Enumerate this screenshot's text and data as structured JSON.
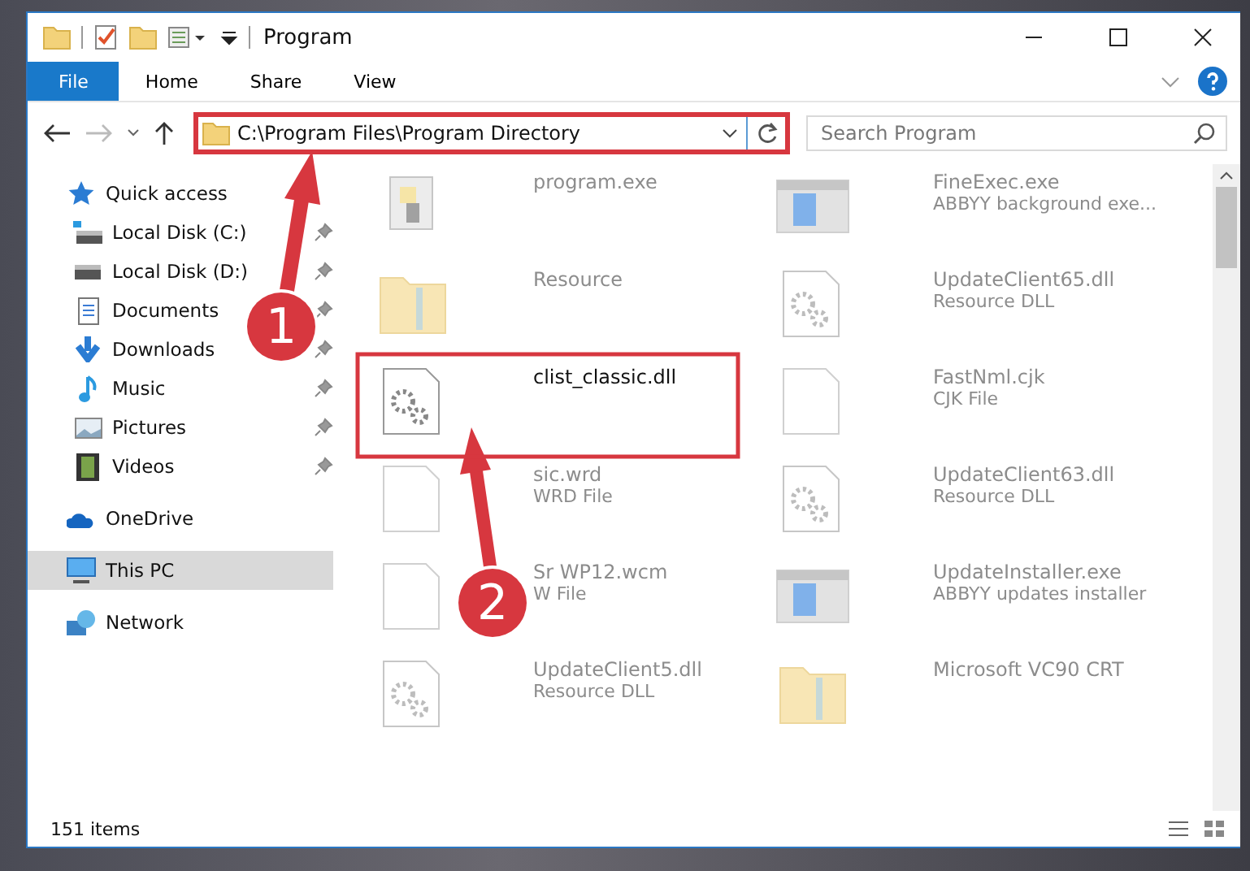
{
  "window": {
    "title": "Program"
  },
  "ribbon": {
    "tabs": [
      {
        "label": "File",
        "kind": "file"
      },
      {
        "label": "Home",
        "kind": "tab"
      },
      {
        "label": "Share",
        "kind": "tab"
      },
      {
        "label": "View",
        "kind": "tab"
      }
    ]
  },
  "address_bar": {
    "path": "C:\\Program Files\\Program Directory",
    "highlighted": true
  },
  "search": {
    "placeholder": "Search Program"
  },
  "nav_pane": {
    "items": [
      {
        "label": "Quick access",
        "selected": false,
        "children": [
          {
            "label": "Local Disk (C:)",
            "selected": false,
            "pinned": true
          },
          {
            "label": "Local Disk (D:)",
            "selected": false,
            "pinned": true
          },
          {
            "label": "Documents",
            "selected": false,
            "pinned": true
          },
          {
            "label": "Downloads",
            "selected": false,
            "pinned": true
          },
          {
            "label": "Music",
            "selected": false,
            "pinned": true
          },
          {
            "label": "Pictures",
            "selected": false,
            "pinned": true
          },
          {
            "label": "Videos",
            "selected": false,
            "pinned": true
          }
        ]
      },
      {
        "label": "OneDrive",
        "selected": false
      },
      {
        "label": "This PC",
        "selected": true
      },
      {
        "label": "Network",
        "selected": false
      }
    ]
  },
  "files": [
    {
      "name": "program.exe",
      "kind": "exe",
      "highlighted": false
    },
    {
      "name": "FineExec.exe",
      "type": "ABBYY background exe...",
      "kind": "app",
      "highlighted": false
    },
    {
      "name": "Resource",
      "kind": "folder",
      "highlighted": false
    },
    {
      "name": "UpdateClient65.dll",
      "type": "Resource DLL",
      "kind": "dll",
      "highlighted": false
    },
    {
      "name": "clist_classic.dll",
      "kind": "dll",
      "highlighted": true
    },
    {
      "name": "FastNml.cjk",
      "type": "CJK File",
      "kind": "file",
      "highlighted": false
    },
    {
      "name": "sic.wrd",
      "type": "WRD File",
      "kind": "file",
      "highlighted": false
    },
    {
      "name": "UpdateClient63.dll",
      "type": "Resource DLL",
      "kind": "dll",
      "highlighted": false
    },
    {
      "name": "Sr WP12.wcm",
      "type": "W File",
      "kind": "file",
      "highlighted": false
    },
    {
      "name": "UpdateInstaller.exe",
      "type": "ABBYY updates installer",
      "kind": "app",
      "highlighted": false
    },
    {
      "name": "UpdateClient5.dll",
      "type": "Resource DLL",
      "kind": "dll",
      "highlighted": false
    },
    {
      "name": "Microsoft VC90 CRT",
      "kind": "folder",
      "highlighted": false
    }
  ],
  "annotations": [
    {
      "number": "1"
    },
    {
      "number": "2"
    }
  ],
  "status_bar": {
    "count": "151 items"
  }
}
